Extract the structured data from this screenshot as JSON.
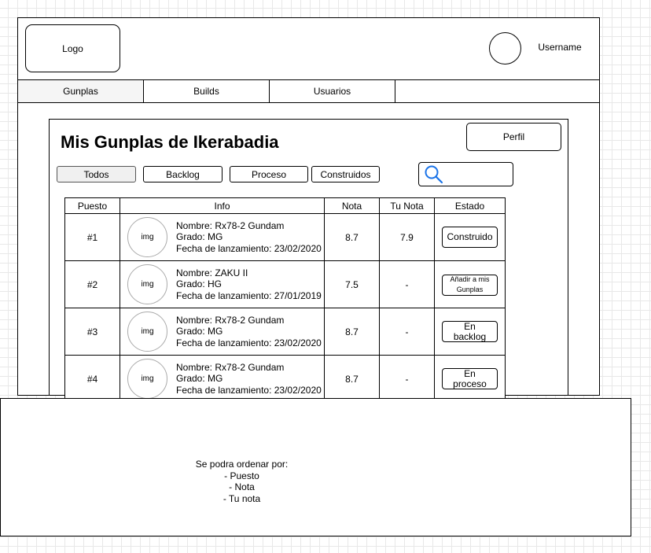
{
  "header": {
    "logo_label": "Logo",
    "username": "Username"
  },
  "nav": {
    "tabs": [
      {
        "label": "Gunplas",
        "active": true
      },
      {
        "label": "Builds",
        "active": false
      },
      {
        "label": "Usuarios",
        "active": false
      }
    ]
  },
  "main": {
    "title": "Mis Gunplas de Ikerabadia",
    "profile_button": "Perfil",
    "filters": [
      {
        "label": "Todos",
        "active": true
      },
      {
        "label": "Backlog",
        "active": false
      },
      {
        "label": "Proceso",
        "active": false
      },
      {
        "label": "Construidos",
        "active": false
      }
    ],
    "search_placeholder": ""
  },
  "table": {
    "columns": [
      "Puesto",
      "Info",
      "Nota",
      "Tu Nota",
      "Estado"
    ],
    "rows": [
      {
        "rank": "#1",
        "img": "img",
        "name": "Nombre: Rx78-2 Gundam",
        "grade": "Grado: MG",
        "release": "Fecha de lanzamiento: 23/02/2020",
        "score": "8.7",
        "my_score": "7.9",
        "state_lines": [
          "Construido"
        ]
      },
      {
        "rank": "#2",
        "img": "img",
        "name": "Nombre: ZAKU II",
        "grade": "Grado: HG",
        "release": "Fecha de lanzamiento: 27/01/2019",
        "score": "7.5",
        "my_score": "-",
        "state_lines": [
          "Añadir a mis",
          "Gunplas"
        ]
      },
      {
        "rank": "#3",
        "img": "img",
        "name": "Nombre: Rx78-2 Gundam",
        "grade": "Grado: MG",
        "release": "Fecha de lanzamiento: 23/02/2020",
        "score": "8.7",
        "my_score": "-",
        "state_lines": [
          "En",
          "backlog"
        ]
      },
      {
        "rank": "#4",
        "img": "img",
        "name": "Nombre: Rx78-2 Gundam",
        "grade": "Grado: MG",
        "release": "Fecha de lanzamiento: 23/02/2020",
        "score": "8.7",
        "my_score": "-",
        "state_lines": [
          "En",
          "proceso"
        ]
      }
    ]
  },
  "note": {
    "lines": [
      "Se podra ordenar por:",
      "- Puesto",
      "- Nota",
      "- Tu nota"
    ]
  },
  "colors": {
    "border": "#000000",
    "active_tab_bg": "#f5f5f5",
    "search_icon": "#1a73e8"
  }
}
